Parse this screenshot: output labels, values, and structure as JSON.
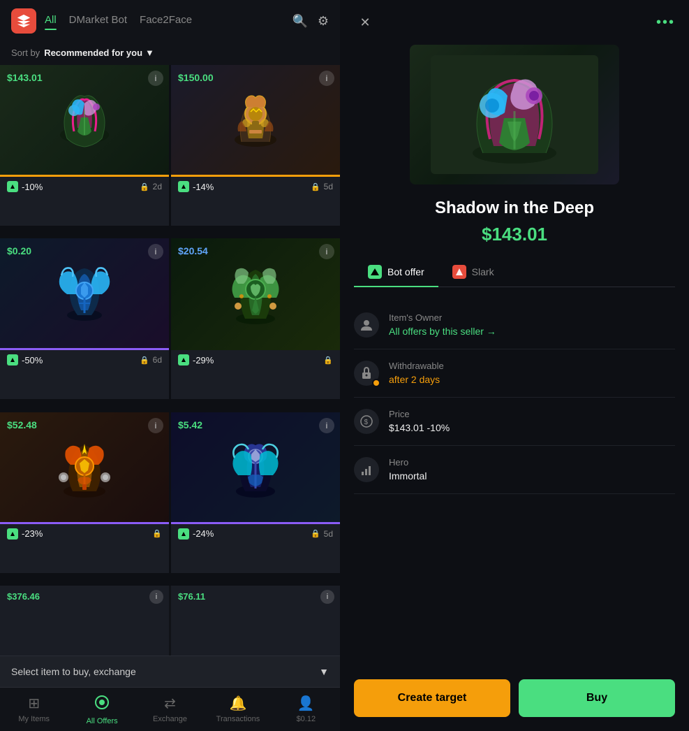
{
  "app": {
    "name": "DMarket"
  },
  "left": {
    "nav": {
      "tabs": [
        {
          "id": "all",
          "label": "All",
          "active": true
        },
        {
          "id": "dmarket-bot",
          "label": "DMarket Bot",
          "active": false
        },
        {
          "id": "face2face",
          "label": "Face2Face",
          "active": false
        }
      ]
    },
    "sort": {
      "prefix": "Sort by",
      "value": "Recommended for you"
    },
    "items": [
      {
        "id": 1,
        "price": "$143.01",
        "priceClass": "price-green",
        "discount": "-10%",
        "lockDays": "2d",
        "hasLock": true
      },
      {
        "id": 2,
        "price": "$150.00",
        "priceClass": "price-green",
        "discount": "-14%",
        "lockDays": "5d",
        "hasLock": true
      },
      {
        "id": 3,
        "price": "$0.20",
        "priceClass": "price-green",
        "discount": "-50%",
        "lockDays": "6d",
        "hasLock": true
      },
      {
        "id": 4,
        "price": "$20.54",
        "priceClass": "price-blue",
        "discount": "-29%",
        "lockDays": "",
        "hasLock": true
      },
      {
        "id": 5,
        "price": "$52.48",
        "priceClass": "price-green",
        "discount": "-23%",
        "lockDays": "",
        "hasLock": true
      },
      {
        "id": 6,
        "price": "$5.42",
        "priceClass": "price-green",
        "discount": "-24%",
        "lockDays": "5d",
        "hasLock": true
      }
    ],
    "partialItems": [
      {
        "price": "$376.46"
      },
      {
        "price": "$76.11"
      }
    ],
    "bottomSelect": {
      "label": "Select item to buy, exchange"
    },
    "bottomNav": [
      {
        "id": "my-items",
        "label": "My Items",
        "icon": "⊞",
        "active": false
      },
      {
        "id": "all-offers",
        "label": "All Offers",
        "icon": "●",
        "active": true
      },
      {
        "id": "exchange",
        "label": "Exchange",
        "icon": "⇄",
        "active": false
      },
      {
        "id": "transactions",
        "label": "Transactions",
        "icon": "🔔",
        "active": false
      },
      {
        "id": "balance",
        "label": "$0.12",
        "icon": "👤",
        "active": false
      }
    ]
  },
  "right": {
    "item": {
      "title": "Shadow in the Deep",
      "price": "$143.01",
      "offerTabs": [
        {
          "id": "bot-offer",
          "label": "Bot offer",
          "active": true,
          "iconType": "dmarket"
        },
        {
          "id": "slark",
          "label": "Slark",
          "active": false,
          "iconType": "game"
        }
      ],
      "details": [
        {
          "id": "owner",
          "icon": "👤",
          "label": "Item's Owner",
          "value": "All offers by this seller →",
          "valueType": "green-link",
          "hasWarning": false
        },
        {
          "id": "withdrawable",
          "icon": "🔒",
          "label": "Withdrawable",
          "value": "after 2 days",
          "valueType": "orange",
          "hasWarning": true
        },
        {
          "id": "price",
          "icon": "💰",
          "label": "Price",
          "value": "$143.01  -10%",
          "valueType": "normal",
          "hasWarning": false
        },
        {
          "id": "hero",
          "icon": "📊",
          "label": "Hero",
          "value": "Immortal",
          "valueType": "normal",
          "hasWarning": false
        }
      ],
      "buttons": {
        "createTarget": "Create target",
        "buy": "Buy"
      }
    }
  }
}
